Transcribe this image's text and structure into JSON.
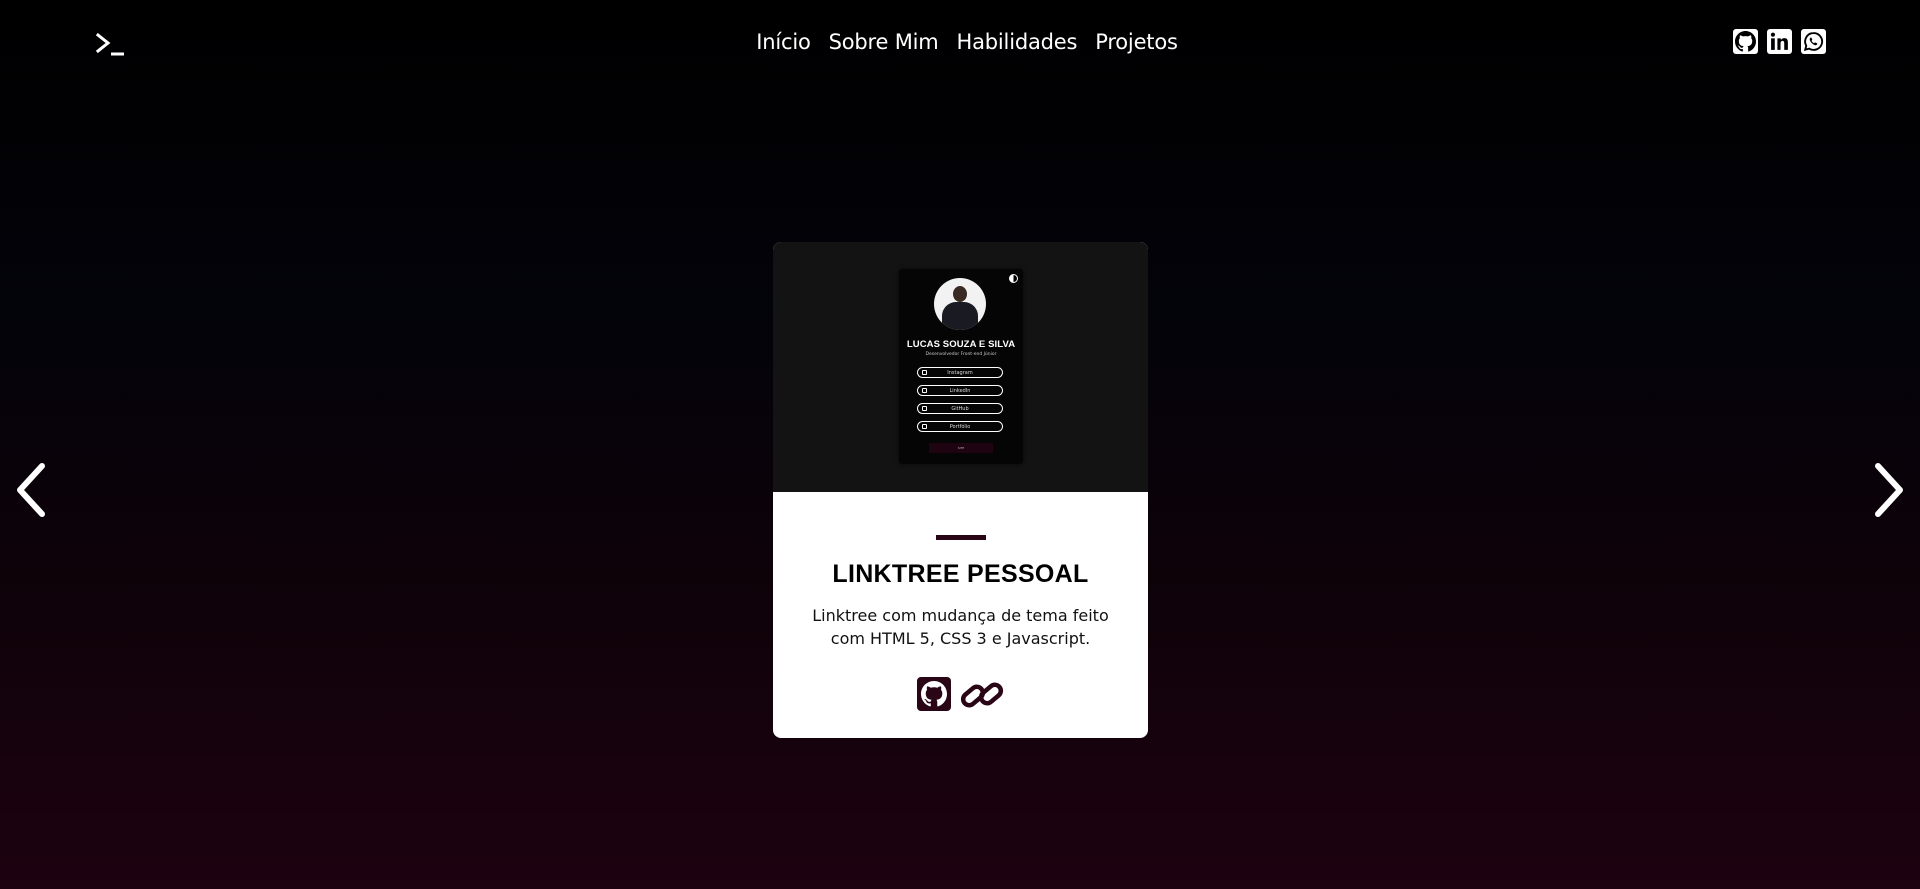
{
  "header": {
    "logo": "terminal-icon",
    "nav": [
      "Início",
      "Sobre Mim",
      "Habilidades",
      "Projetos"
    ],
    "socials": [
      "github-icon",
      "linkedin-icon",
      "whatsapp-icon"
    ]
  },
  "carousel": {
    "prev": "chevron-left-icon",
    "next": "chevron-right-icon"
  },
  "project": {
    "preview": {
      "name": "LUCAS SOUZA E SILVA",
      "subtitle": "Desenvolvedor Front-end Júnior",
      "buttons": [
        "Instagram",
        "LinkedIn",
        "GitHub",
        "Portfólio"
      ],
      "footer": "SITE"
    },
    "title": "LINKTREE PESSOAL",
    "description": "Linktree com mudança de tema feito com HTML 5, CSS 3 e Javascript.",
    "accent": "#2a0515"
  }
}
